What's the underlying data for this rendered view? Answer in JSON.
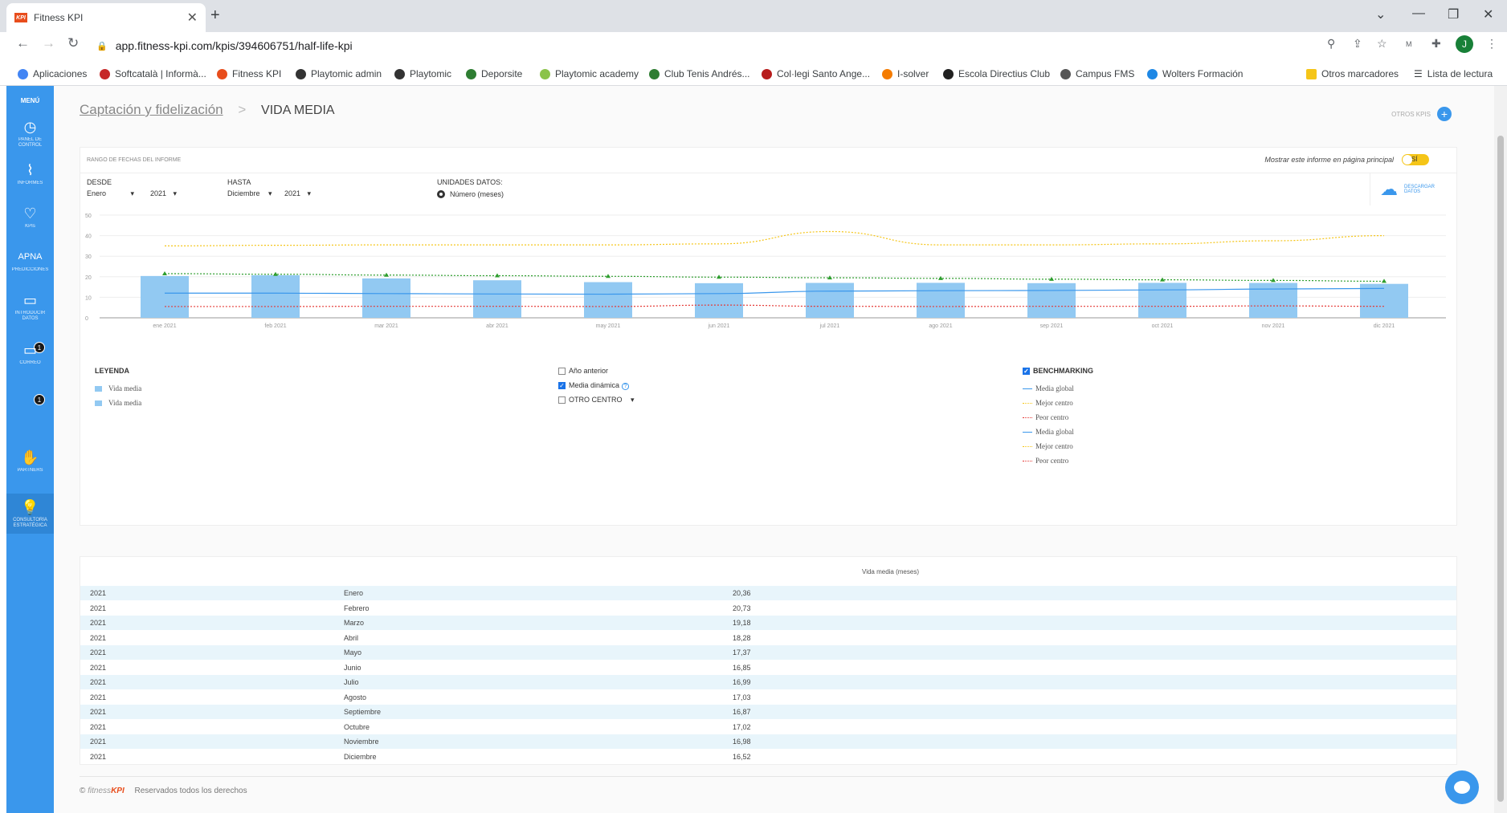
{
  "browser": {
    "tab_title": "Fitness KPI",
    "tab_icon": "KPI",
    "url": "app.fitness-kpi.com/kpis/394606751/half-life-kpi",
    "profile_initial": "J",
    "bookmarks": [
      {
        "label": "Aplicaciones",
        "color": "#4285f4"
      },
      {
        "label": "Softcatalà | Informà...",
        "color": "#c62828"
      },
      {
        "label": "Fitness KPI",
        "color": "#e84d1c"
      },
      {
        "label": "Playtomic admin",
        "color": "#333333"
      },
      {
        "label": "Playtomic",
        "color": "#333333"
      },
      {
        "label": "Deporsite",
        "color": "#2e7d32"
      },
      {
        "label": "Playtomic academy",
        "color": "#8bc34a"
      },
      {
        "label": "Club Tenis Andrés...",
        "color": "#2e7d32"
      },
      {
        "label": "Col·legi Santo Ange...",
        "color": "#b71c1c"
      },
      {
        "label": "I-solver",
        "color": "#f57c00"
      },
      {
        "label": "Escola Directius Club",
        "color": "#212121"
      },
      {
        "label": "Campus FMS",
        "color": "#555555"
      },
      {
        "label": "Wolters Formación",
        "color": "#1e88e5"
      }
    ],
    "other_bookmarks": "Otros marcadores",
    "reading_list": "Lista de lectura"
  },
  "sidebar": {
    "menu": "MENÚ",
    "items": [
      {
        "label": "PANEL DE CONTROL",
        "icon": "clock-icon"
      },
      {
        "label": "INFORMES",
        "icon": "chart-icon"
      },
      {
        "label": "KPIs",
        "icon": "heart-icon"
      },
      {
        "label": "PREDICCIONES",
        "icon": "apna-icon",
        "text": "APNA"
      },
      {
        "label": "INTRODUCIR DATOS",
        "icon": "input-icon",
        "badge": "1"
      },
      {
        "label": "CORREO",
        "icon": "mail-icon",
        "badge": "1"
      },
      {
        "label": "PARTNERS",
        "icon": "handshake-icon"
      },
      {
        "label": "CONSULTORÍA ESTRATÉGICA",
        "icon": "lightbulb-icon"
      }
    ]
  },
  "breadcrumb": {
    "parent": "Captación y fidelización",
    "separator": ">",
    "current": "VIDA MEDIA"
  },
  "otros_kpis": "OTROS KPIS",
  "report": {
    "range_title": "RANGO DE FECHAS DEL INFORME",
    "show_main": "Mostrar este informe en página principal",
    "toggle": "SÍ",
    "desde_label": "DESDE",
    "desde_month": "Enero",
    "desde_year": "2021",
    "hasta_label": "HASTA",
    "hasta_month": "Diciembre",
    "hasta_year": "2021",
    "unidades_label": "UNIDADES DATOS:",
    "unidades_value": "Número (meses)",
    "download": "DESCARGAR DATOS"
  },
  "chart_data": {
    "type": "bar",
    "categories": [
      "ene 2021",
      "feb 2021",
      "mar 2021",
      "abr 2021",
      "may 2021",
      "jun 2021",
      "jul 2021",
      "ago 2021",
      "sep 2021",
      "oct 2021",
      "nov 2021",
      "dic 2021"
    ],
    "ylim": [
      0,
      50
    ],
    "yticks": [
      0,
      10,
      20,
      30,
      40,
      50
    ],
    "grid": true,
    "series": [
      {
        "name": "Vida media",
        "kind": "bar",
        "color": "#92c9f2",
        "values": [
          20.36,
          20.73,
          19.18,
          18.28,
          17.37,
          16.85,
          16.99,
          17.03,
          16.87,
          17.02,
          16.98,
          16.52
        ]
      },
      {
        "name": "Media dinámica",
        "kind": "line",
        "style": "dotted-markers",
        "color": "#2e9e2e",
        "values": [
          21.5,
          21.2,
          20.8,
          20.5,
          20.2,
          19.8,
          19.5,
          19.2,
          18.8,
          18.5,
          18.2,
          17.8
        ]
      },
      {
        "name": "Media global",
        "kind": "line",
        "style": "solid",
        "color": "#3a97ec",
        "values": [
          12,
          12,
          11.8,
          11.6,
          11.5,
          11.8,
          13,
          13.2,
          13.3,
          13.6,
          14,
          14.3
        ]
      },
      {
        "name": "Mejor centro",
        "kind": "line",
        "style": "dotted",
        "color": "#f5c518",
        "values": [
          35,
          35.3,
          35.5,
          35.5,
          35.5,
          36,
          42,
          35.5,
          35.5,
          36,
          37.5,
          40
        ]
      },
      {
        "name": "Peor centro",
        "kind": "line",
        "style": "dotted",
        "color": "#e53935",
        "values": [
          5.5,
          5.5,
          5.6,
          5.6,
          5.5,
          6.2,
          5.6,
          5.5,
          5.6,
          5.6,
          5.8,
          5.6
        ]
      }
    ]
  },
  "legend": {
    "title": "LEYENDA",
    "items": [
      "Vida media",
      "Vida media"
    ],
    "anio_anterior": "Año anterior",
    "media_dinamica": "Media dinámica",
    "otro_centro": "OTRO CENTRO",
    "benchmarking": "BENCHMARKING",
    "bench_items": [
      {
        "label": "Media global",
        "color": "#3a97ec",
        "style": "solid"
      },
      {
        "label": "Mejor centro",
        "color": "#f5c518",
        "style": "dotted"
      },
      {
        "label": "Peor centro",
        "color": "#e53935",
        "style": "dotted"
      },
      {
        "label": "Media global",
        "color": "#3a97ec",
        "style": "solid"
      },
      {
        "label": "Mejor centro",
        "color": "#f5c518",
        "style": "dotted"
      },
      {
        "label": "Peor centro",
        "color": "#e53935",
        "style": "dotted"
      }
    ]
  },
  "table": {
    "header": "Vida media (meses)",
    "rows": [
      {
        "year": "2021",
        "month": "Enero",
        "value": "20,36"
      },
      {
        "year": "2021",
        "month": "Febrero",
        "value": "20,73"
      },
      {
        "year": "2021",
        "month": "Marzo",
        "value": "19,18"
      },
      {
        "year": "2021",
        "month": "Abril",
        "value": "18,28"
      },
      {
        "year": "2021",
        "month": "Mayo",
        "value": "17,37"
      },
      {
        "year": "2021",
        "month": "Junio",
        "value": "16,85"
      },
      {
        "year": "2021",
        "month": "Julio",
        "value": "16,99"
      },
      {
        "year": "2021",
        "month": "Agosto",
        "value": "17,03"
      },
      {
        "year": "2021",
        "month": "Septiembre",
        "value": "16,87"
      },
      {
        "year": "2021",
        "month": "Octubre",
        "value": "17,02"
      },
      {
        "year": "2021",
        "month": "Noviembre",
        "value": "16,98"
      },
      {
        "year": "2021",
        "month": "Diciembre",
        "value": "16,52"
      }
    ]
  },
  "footer": {
    "brand_pre": "fitness",
    "brand_kpi": "KPI",
    "copy": "©",
    "rights": "Reservados todos los derechos"
  }
}
